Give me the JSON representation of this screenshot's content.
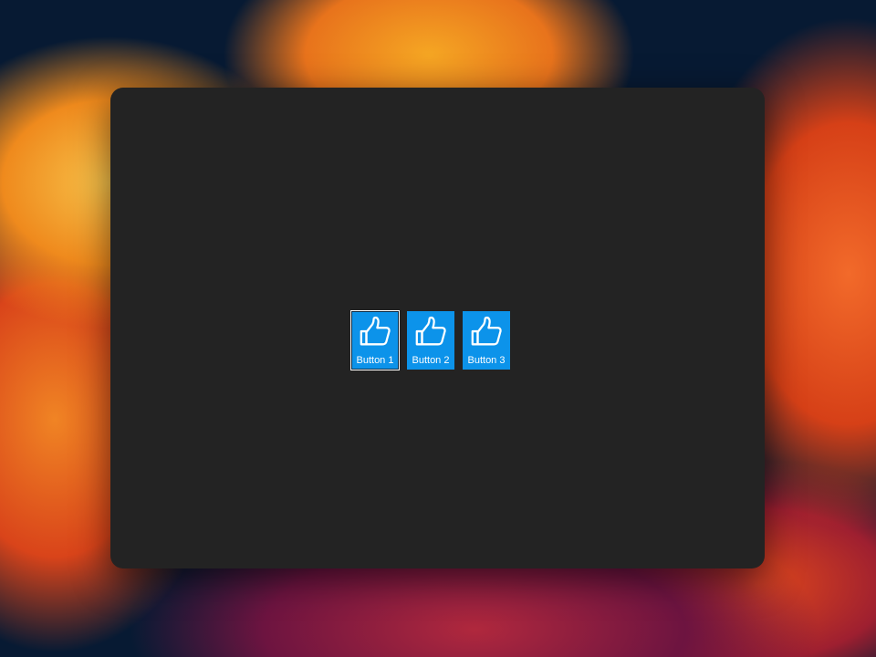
{
  "colors": {
    "window_background": "#232323",
    "button_background": "#0c93ea",
    "button_text": "#ffffff",
    "focus_ring": "#ffffff"
  },
  "buttons": [
    {
      "label": "Button 1",
      "icon": "thumbs-up-icon",
      "focused": true
    },
    {
      "label": "Button 2",
      "icon": "thumbs-up-icon",
      "focused": false
    },
    {
      "label": "Button 3",
      "icon": "thumbs-up-icon",
      "focused": false
    }
  ]
}
